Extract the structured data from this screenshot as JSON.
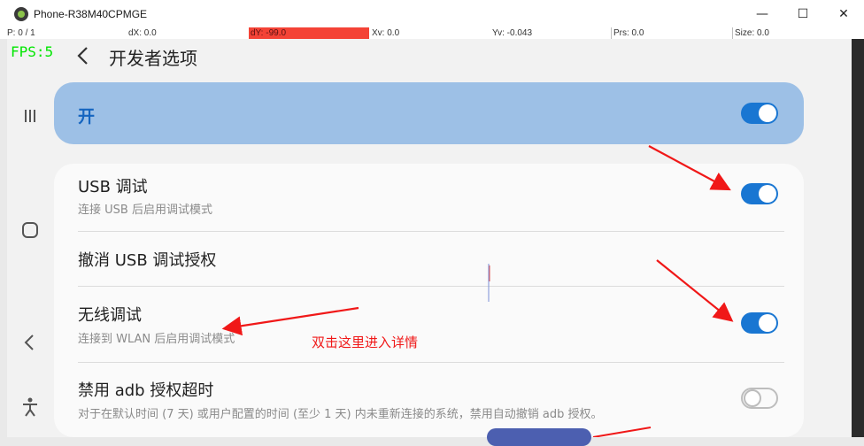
{
  "window": {
    "title": "Phone-R38M40CPMGE",
    "minimize": "—",
    "maximize": "☐",
    "close": "✕"
  },
  "debug": {
    "p": "P: 0 / 1",
    "dx": "dX: 0.0",
    "dy": "dY: -99.0",
    "xv": "Xv: 0.0",
    "yv": "Yv: -0.043",
    "prs": "Prs: 0.0",
    "size": "Size: 0.0"
  },
  "fps": "FPS:5",
  "header": {
    "back": "‹",
    "title": "开发者选项"
  },
  "master": {
    "label": "开",
    "enabled": true
  },
  "settings": [
    {
      "title": "USB 调试",
      "subtitle": "连接 USB 后启用调试模式",
      "toggle": true
    },
    {
      "title": "撤消 USB 调试授权",
      "subtitle": "",
      "toggle": null
    },
    {
      "title": "无线调试",
      "subtitle": "连接到 WLAN 后启用调试模式",
      "toggle": true
    },
    {
      "title": "禁用 adb 授权超时",
      "subtitle": "对于在默认时间 (7 天) 或用户配置的时间 (至少 1 天) 内未重新连接的系统，禁用自动撤销 adb 授权。",
      "toggle": false
    }
  ],
  "annotation": "双击这里进入详情",
  "colors": {
    "accent": "#1976d2",
    "master_card": "#9dc0e6",
    "annotation": "#f01818",
    "fps": "#00e600"
  }
}
